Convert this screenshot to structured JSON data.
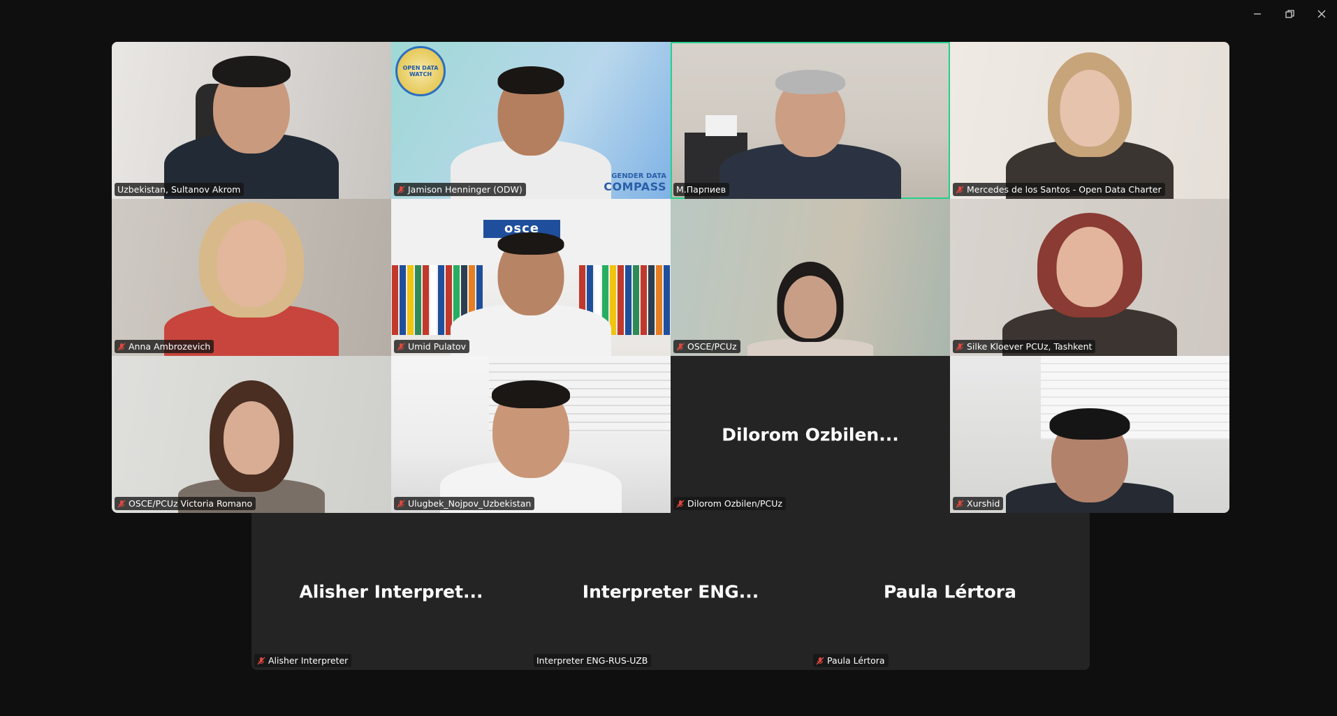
{
  "window_controls": {
    "minimize_icon": "minimize-icon",
    "restore_icon": "restore-icon",
    "close_icon": "close-icon"
  },
  "colors": {
    "active_speaker_border": "#23d18b",
    "muted_icon": "#e0483e",
    "tile_background": "#242424",
    "app_background": "#0f0f0f"
  },
  "participants": [
    {
      "name": "Uzbekistan, Sultanov Akrom",
      "muted": false,
      "video": true
    },
    {
      "name": "Jamison Henninger (ODW)",
      "muted": true,
      "video": true,
      "logo_text": "OPEN DATA WATCH",
      "overlay_line1": "GENDER DATA",
      "overlay_line2": "COMPASS"
    },
    {
      "name": "М.Парпиев",
      "muted": false,
      "video": true,
      "active_speaker": true
    },
    {
      "name": "Mercedes de los Santos - Open Data Charter",
      "muted": true,
      "video": true
    },
    {
      "name": "Anna Ambrozevich",
      "muted": true,
      "video": true
    },
    {
      "name": "Umid Pulatov",
      "muted": true,
      "video": true,
      "sign_text": "osce"
    },
    {
      "name": "OSCE/PCUz",
      "muted": true,
      "video": true
    },
    {
      "name": "Silke Kloever PCUz, Tashkent",
      "muted": true,
      "video": true
    },
    {
      "name": "OSCE/PCUz Victoria Romano",
      "muted": true,
      "video": true
    },
    {
      "name": "Ulugbek_Nojpov_Uzbekistan",
      "muted": true,
      "video": true
    },
    {
      "name": "Dilorom Ozbilen/PCUz",
      "muted": true,
      "video": false,
      "display_name": "Dilorom  Ozbilen..."
    },
    {
      "name": "Xurshid",
      "muted": true,
      "video": true
    }
  ],
  "bottom_participants": [
    {
      "name": "Alisher Interpreter",
      "muted": true,
      "display_name": "Alisher  Interpret..."
    },
    {
      "name": "Interpreter ENG-RUS-UZB",
      "muted": false,
      "display_name": "Interpreter  ENG..."
    },
    {
      "name": "Paula Lértora",
      "muted": true,
      "display_name": "Paula Lértora"
    }
  ]
}
